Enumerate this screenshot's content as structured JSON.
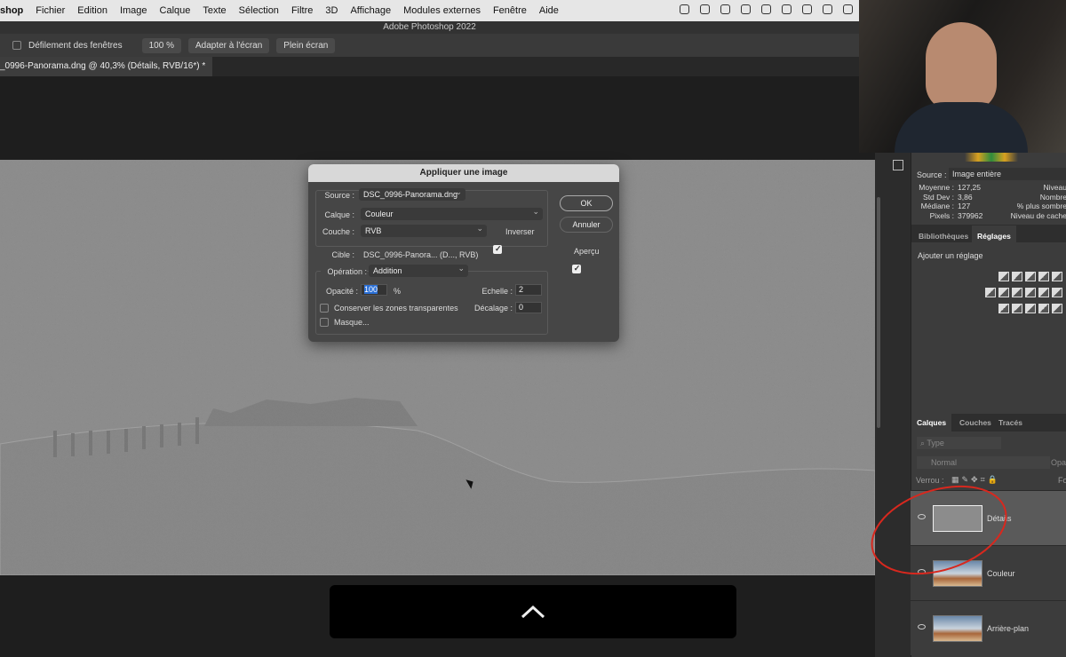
{
  "menubar": {
    "app": "shop",
    "items": [
      "Fichier",
      "Edition",
      "Image",
      "Calque",
      "Texte",
      "Sélection",
      "Filtre",
      "3D",
      "Affichage",
      "Modules externes",
      "Fenêtre",
      "Aide"
    ]
  },
  "window_title": "Adobe Photoshop 2022",
  "options": {
    "scroll_all_label": "Défilement des fenêtres",
    "zoom_100": "100 %",
    "fit_screen": "Adapter à l'écran",
    "full_screen": "Plein écran"
  },
  "document_tab": "_0996-Panorama.dng @ 40,3% (Détails, RVB/16*) *",
  "dialog": {
    "title": "Appliquer une image",
    "source_label": "Source :",
    "source_value": "DSC_0996-Panorama.dng",
    "layer_label": "Calque :",
    "layer_value": "Couleur",
    "channel_label": "Couche :",
    "channel_value": "RVB",
    "invert_label": "Inverser",
    "invert_checked": true,
    "target_label": "Cible :",
    "target_value": "DSC_0996-Panora... (D..., RVB)",
    "operation_label": "Opération :",
    "operation_value": "Addition",
    "opacity_label": "Opacité :",
    "opacity_value": "100",
    "opacity_unit": "%",
    "scale_label": "Echelle :",
    "scale_value": "2",
    "offset_label": "Décalage :",
    "offset_value": "0",
    "preserve_label": "Conserver les zones transparentes",
    "preserve_checked": false,
    "mask_label": "Masque...",
    "mask_checked": false,
    "ok": "OK",
    "cancel": "Annuler",
    "preview_label": "Aperçu",
    "preview_checked": true
  },
  "histogram": {
    "source_label": "Source :",
    "source_value": "Image entière",
    "stats": [
      {
        "label": "Moyenne :",
        "value": "127,25",
        "right": "Niveau"
      },
      {
        "label": "Std Dev :",
        "value": "3,86",
        "right": "Nombre"
      },
      {
        "label": "Médiane :",
        "value": "127",
        "right": "% plus sombre"
      },
      {
        "label": "Pixels :",
        "value": "379962",
        "right": "Niveau de cache"
      }
    ]
  },
  "adjust_tabs": [
    "Bibliothèques",
    "Réglages"
  ],
  "adjust_title": "Ajouter un réglage",
  "layer_tabs": [
    "Calques",
    "Couches",
    "Tracés"
  ],
  "layer_search_placeholder": "Type",
  "blend_mode": "Normal",
  "opacity_short": "Opa",
  "lock_label": "Verrou :",
  "fill_short": "Fo",
  "layers": [
    {
      "name": "Détails",
      "selected": true
    },
    {
      "name": "Couleur"
    },
    {
      "name": "Arrière-plan"
    }
  ],
  "annotation_color": "#d8281e"
}
